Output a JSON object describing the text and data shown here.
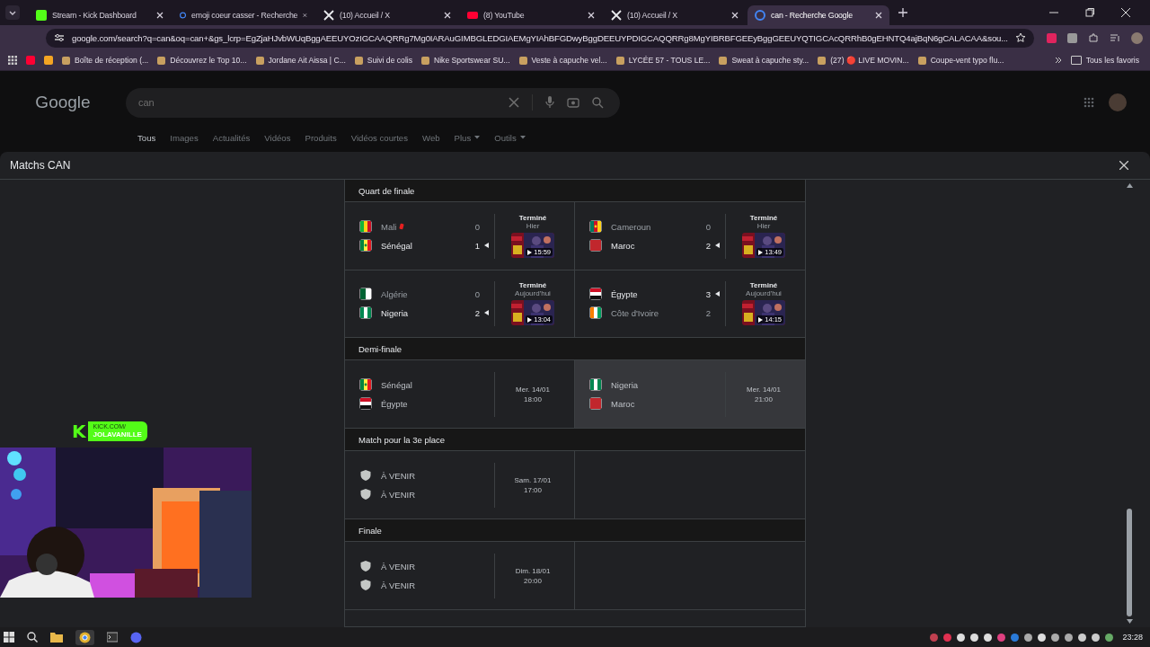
{
  "browser": {
    "tabs": [
      {
        "title": "Stream - Kick Dashboard",
        "kind": "kick",
        "selected": false
      },
      {
        "title": "emoji coeur casser - Recherche",
        "kind": "google",
        "selected": false
      },
      {
        "title": "(10) Accueil / X",
        "kind": "x",
        "selected": false
      },
      {
        "title": "(8) YouTube",
        "kind": "youtube",
        "selected": false
      },
      {
        "title": "(10) Accueil / X",
        "kind": "x",
        "selected": false
      },
      {
        "title": "can - Recherche Google",
        "kind": "google",
        "selected": true
      }
    ],
    "url": "google.com/search?q=can&oq=can+&gs_lcrp=EgZjaHJvbWUqBggAEEUYOzIGCAAQRRg7Mg0IARAuGIMBGLEDGIAEMgYIAhBFGDwyBggDEEUYPDIGCAQQRRg8MgYIBRBFGEEyBggGEEUYQTIGCAcQRRhB0gEHNTQ4ajBqN6gCALACAA&sou...",
    "bookmarks": [
      "Boîte de réception (...",
      "Découvrez le Top 10...",
      "Jordane Ait Aissa | C...",
      "Suivi de colis",
      "Nike Sportswear SU...",
      "Veste à capuche vel...",
      "LYCÉE 57 - TOUS LE...",
      "Sweat à capuche sty...",
      "(27) 🔴 LIVE MOVIN...",
      "Coupe-vent typo flu..."
    ],
    "all_bookmarks": "Tous les favoris"
  },
  "google": {
    "logo": "Google",
    "query": "can",
    "nav": [
      {
        "label": "Tous",
        "selected": true,
        "dropdown": false
      },
      {
        "label": "Images",
        "selected": false,
        "dropdown": false
      },
      {
        "label": "Actualités",
        "selected": false,
        "dropdown": false
      },
      {
        "label": "Vidéos",
        "selected": false,
        "dropdown": false
      },
      {
        "label": "Produits",
        "selected": false,
        "dropdown": false
      },
      {
        "label": "Vidéos courtes",
        "selected": false,
        "dropdown": false
      },
      {
        "label": "Web",
        "selected": false,
        "dropdown": false
      },
      {
        "label": "Plus",
        "selected": false,
        "dropdown": true
      },
      {
        "label": "Outils",
        "selected": false,
        "dropdown": true
      }
    ]
  },
  "dialog": {
    "title": "Matchs CAN",
    "rounds": [
      {
        "title": "Quart de finale",
        "matches": [
          {
            "status": "Terminé",
            "day": "Hier",
            "duration": "15:59",
            "highlighted": false,
            "teams": [
              {
                "name": "Mali",
                "kind": "mali",
                "score": "0",
                "winner": false,
                "red_card": true
              },
              {
                "name": "Sénégal",
                "kind": "senegal",
                "score": "1",
                "winner": true,
                "red_card": false
              }
            ]
          },
          {
            "status": "Terminé",
            "day": "Hier",
            "duration": "13:49",
            "highlighted": false,
            "teams": [
              {
                "name": "Cameroun",
                "kind": "cameroun",
                "score": "0",
                "winner": false,
                "red_card": false
              },
              {
                "name": "Maroc",
                "kind": "maroc",
                "score": "2",
                "winner": true,
                "red_card": false
              }
            ]
          },
          {
            "status": "Terminé",
            "day": "Aujourd'hui",
            "duration": "13:04",
            "highlighted": false,
            "teams": [
              {
                "name": "Algérie",
                "kind": "algerie",
                "score": "0",
                "winner": false,
                "red_card": false
              },
              {
                "name": "Nigeria",
                "kind": "nigeria",
                "score": "2",
                "winner": true,
                "red_card": false
              }
            ]
          },
          {
            "status": "Terminé",
            "day": "Aujourd'hui",
            "duration": "14:15",
            "highlighted": false,
            "teams": [
              {
                "name": "Égypte",
                "kind": "egypte",
                "score": "3",
                "winner": true,
                "red_card": false
              },
              {
                "name": "Côte d'Ivoire",
                "kind": "cote_ivoire",
                "score": "2",
                "winner": false,
                "red_card": false
              }
            ]
          }
        ]
      },
      {
        "title": "Demi-finale",
        "matches": [
          {
            "date": "Mer. 14/01",
            "time": "18:00",
            "highlighted": false,
            "teams": [
              {
                "name": "Sénégal",
                "kind": "senegal"
              },
              {
                "name": "Égypte",
                "kind": "egypte"
              }
            ]
          },
          {
            "date": "Mer. 14/01",
            "time": "21:00",
            "highlighted": true,
            "teams": [
              {
                "name": "Nigeria",
                "kind": "nigeria"
              },
              {
                "name": "Maroc",
                "kind": "maroc"
              }
            ]
          }
        ]
      },
      {
        "title": "Match pour la 3e place",
        "matches": [
          {
            "date": "Sam. 17/01",
            "time": "17:00",
            "highlighted": false,
            "teams": [
              {
                "name": "À VENIR",
                "kind": "tbd"
              },
              {
                "name": "À VENIR",
                "kind": "tbd"
              }
            ]
          }
        ]
      },
      {
        "title": "Finale",
        "matches": [
          {
            "date": "Dim. 18/01",
            "time": "20:00",
            "highlighted": false,
            "teams": [
              {
                "name": "À VENIR",
                "kind": "tbd"
              },
              {
                "name": "À VENIR",
                "kind": "tbd"
              }
            ]
          }
        ]
      }
    ]
  },
  "stream_overlay": {
    "logo": "K",
    "line_1": "KICK.COM/",
    "line_2": "JOLAVANILLE"
  },
  "taskbar": {
    "clock": "23:28"
  }
}
